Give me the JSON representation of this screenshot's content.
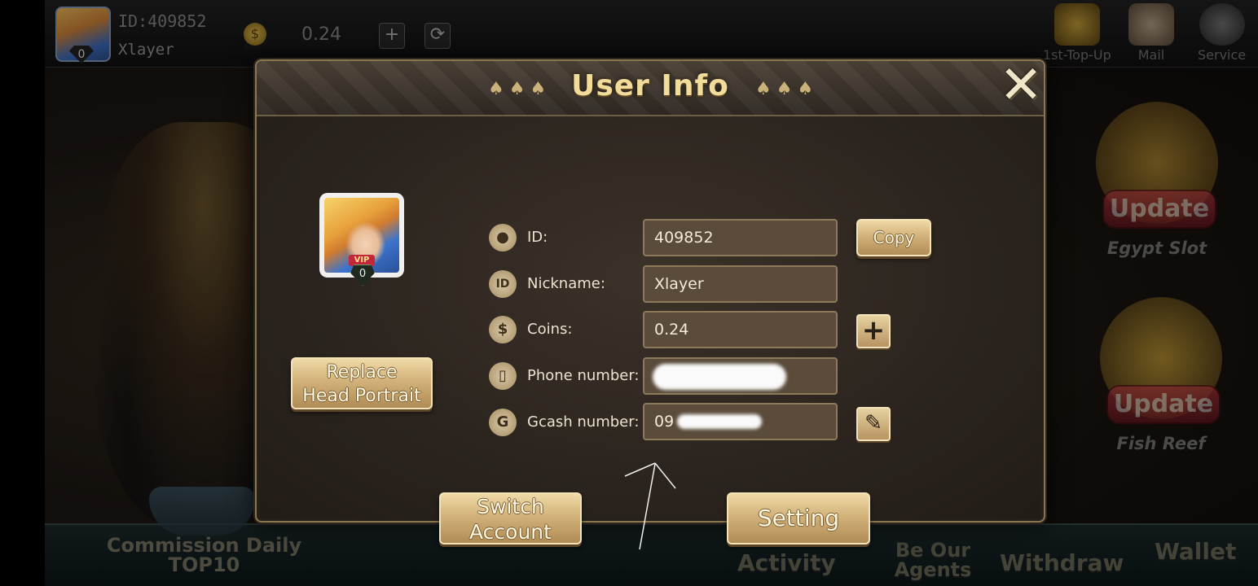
{
  "topbar": {
    "id_text": "ID:409852",
    "name": "Xlayer",
    "vip_level": "0",
    "coins": "0.24",
    "right_items": [
      "1st-Top-Up",
      "Mail",
      "Service"
    ]
  },
  "side_games": [
    {
      "badge": "Update",
      "name": "Egypt Slot"
    },
    {
      "badge": "Update",
      "name": "Fish Reef"
    }
  ],
  "bottom_nav": {
    "commission": "Commission Daily TOP10",
    "activity": "Activity",
    "agents": "Be Our Agents",
    "withdraw": "Withdraw",
    "wallet": "Wallet"
  },
  "dialog": {
    "title": "User Info",
    "avatar_vip_tag": "VIP",
    "avatar_vip_level": "0",
    "replace_label_1": "Replace",
    "replace_label_2": "Head Portrait",
    "switch_label_1": "Switch",
    "switch_label_2": "Account",
    "setting_label": "Setting",
    "copy_label": "Copy",
    "rows": [
      {
        "icon": "user-icon",
        "glyph": "👤",
        "label": "ID:",
        "value": "409852"
      },
      {
        "icon": "id-icon",
        "glyph": "ID",
        "label": "Nickname:",
        "value": "Xlayer"
      },
      {
        "icon": "dollar-icon",
        "glyph": "$",
        "label": "Coins:",
        "value": "0.24"
      },
      {
        "icon": "phone-icon",
        "glyph": "▯",
        "label": "Phone number:",
        "value": ""
      },
      {
        "icon": "gcash-icon",
        "glyph": "G",
        "label": "Gcash number:",
        "value": "09"
      }
    ]
  },
  "colors": {
    "title_gold": "#f2dc9a",
    "button_gold": "#d2b27a",
    "field_bg": "#5a4b3b"
  }
}
